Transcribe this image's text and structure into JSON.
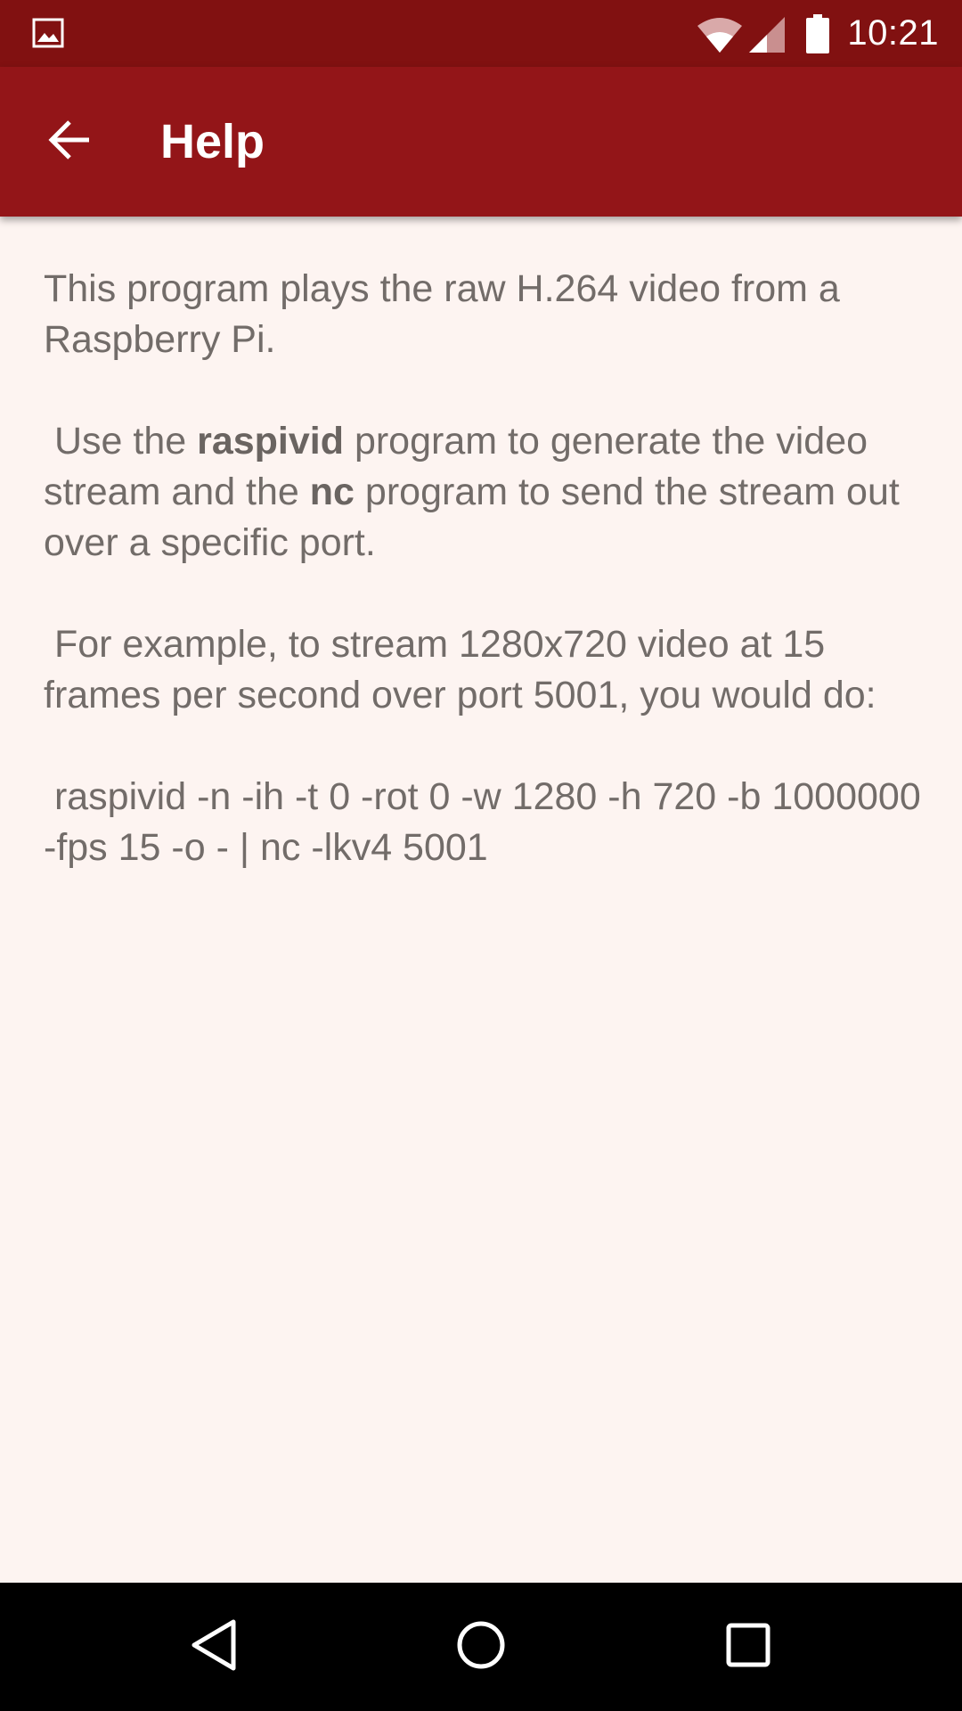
{
  "status_bar": {
    "time": "10:21",
    "icons": [
      "image-icon",
      "wifi-icon",
      "signal-icon",
      "battery-icon"
    ]
  },
  "app_bar": {
    "title": "Help",
    "back_icon": "arrow-back-icon"
  },
  "help": {
    "p1": "This program plays the raw H.264 video from a Raspberry Pi.",
    "p2_a": " Use the ",
    "p2_b": "raspivid",
    "p2_c": " program to generate the video stream and the ",
    "p2_d": "nc",
    "p2_e": " program to send the stream out over a specific port.",
    "p3": " For example, to stream 1280x720 video at 15 frames per second over port 5001, you would do:",
    "p4": " raspivid -n -ih -t 0 -rot 0 -w 1280 -h 720 -b 1000000 -fps 15 -o - | nc -lkv4 5001"
  },
  "nav_bar": {
    "buttons": [
      "back-triangle-icon",
      "home-circle-icon",
      "recents-square-icon"
    ]
  },
  "colors": {
    "status_bar": "#811111",
    "app_bar": "#931518",
    "background": "#fdf4f1",
    "text": "#726c69"
  }
}
